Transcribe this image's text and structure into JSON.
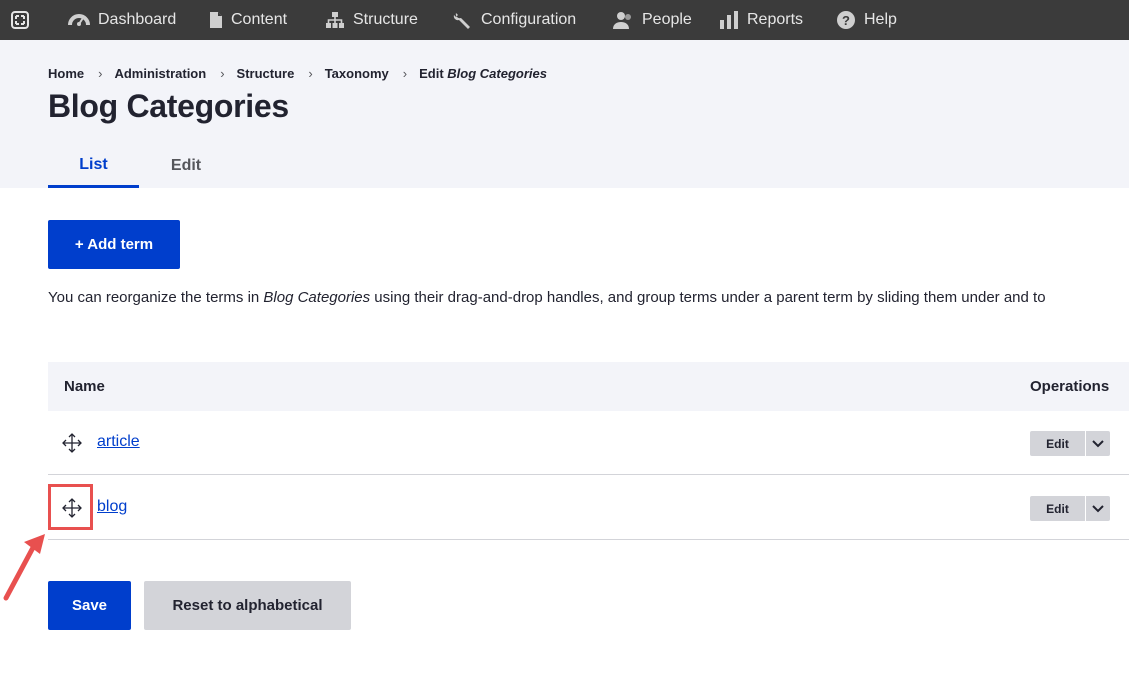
{
  "toolbar": {
    "items": [
      {
        "label": "Dashboard",
        "icon": "dashboard-icon"
      },
      {
        "label": "Content",
        "icon": "document-icon"
      },
      {
        "label": "Structure",
        "icon": "sitemap-icon"
      },
      {
        "label": "Configuration",
        "icon": "wrench-icon"
      },
      {
        "label": "People",
        "icon": "people-icon"
      },
      {
        "label": "Reports",
        "icon": "bar-chart-icon"
      },
      {
        "label": "Help",
        "icon": "help-icon"
      }
    ]
  },
  "breadcrumb": {
    "home": "Home",
    "administration": "Administration",
    "structure": "Structure",
    "taxonomy": "Taxonomy",
    "current_prefix": "Edit",
    "current_em": "Blog Categories",
    "separator": "›"
  },
  "page": {
    "title": "Blog Categories"
  },
  "tabs": [
    {
      "label": "List",
      "active": true
    },
    {
      "label": "Edit",
      "active": false
    }
  ],
  "actions": {
    "add_term": "+ Add term"
  },
  "help": {
    "before": "You can reorganize the terms in ",
    "em": "Blog Categories",
    "after": " using their drag-and-drop handles, and group terms under a parent term by sliding them under and to"
  },
  "table": {
    "headers": {
      "name": "Name",
      "operations": "Operations"
    },
    "rows": [
      {
        "name": "article",
        "operation": "Edit"
      },
      {
        "name": "blog",
        "operation": "Edit"
      }
    ]
  },
  "form": {
    "save": "Save",
    "reset": "Reset to alphabetical"
  },
  "colors": {
    "toolbar_bg": "#3b3b3b",
    "primary": "#003ecc",
    "annotation": "#e8504f"
  }
}
